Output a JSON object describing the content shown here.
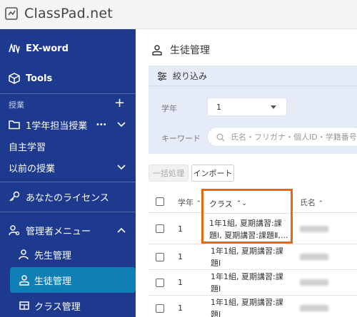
{
  "app": {
    "title": "ClassPad.net"
  },
  "sidebar": {
    "exword": "EX-word",
    "tools": "Tools",
    "lessons_section": "授業",
    "lessons_add": "+",
    "grade_lesson": "1学年担当授業",
    "grade_lesson_more": "•••",
    "self_study": "自主学習",
    "past_lessons": "以前の授業",
    "license": "あなたのライセンス",
    "admin_menu": "管理者メニュー",
    "teacher_mgmt": "先生管理",
    "student_mgmt": "生徒管理",
    "class_mgmt": "クラス管理"
  },
  "page": {
    "title": "生徒管理",
    "filter_title": "絞り込み",
    "grade_label": "学年",
    "grade_value": "1",
    "keyword_label": "キーワード",
    "keyword_placeholder": "氏名・フリガナ・個人ID・学籍番号",
    "bulk_button": "一括処理",
    "import_button": "インポート"
  },
  "table": {
    "headers": {
      "grade": "学年",
      "grade_sort": "⌃",
      "class": "クラス",
      "class_sort": "⌃⌄",
      "name": "氏名",
      "name_sort": "⌃"
    },
    "rows": [
      {
        "grade": "1",
        "class": "1年1組, 夏期講習:課題Ⅰ, 夏期講習:課題Ⅱ,..."
      },
      {
        "grade": "1",
        "class": "1年1組, 夏期講習:課題Ⅰ"
      },
      {
        "grade": "1",
        "class": "1年1組, 夏期講習:課題Ⅰ"
      },
      {
        "grade": "1",
        "class": "1年1組, 夏期講習:課題Ⅰ"
      }
    ]
  },
  "colors": {
    "sidebar": "#1d3a8f",
    "active": "#0f7fb5",
    "highlight": "#e8670f",
    "filter_bg": "#e6ecf7"
  }
}
